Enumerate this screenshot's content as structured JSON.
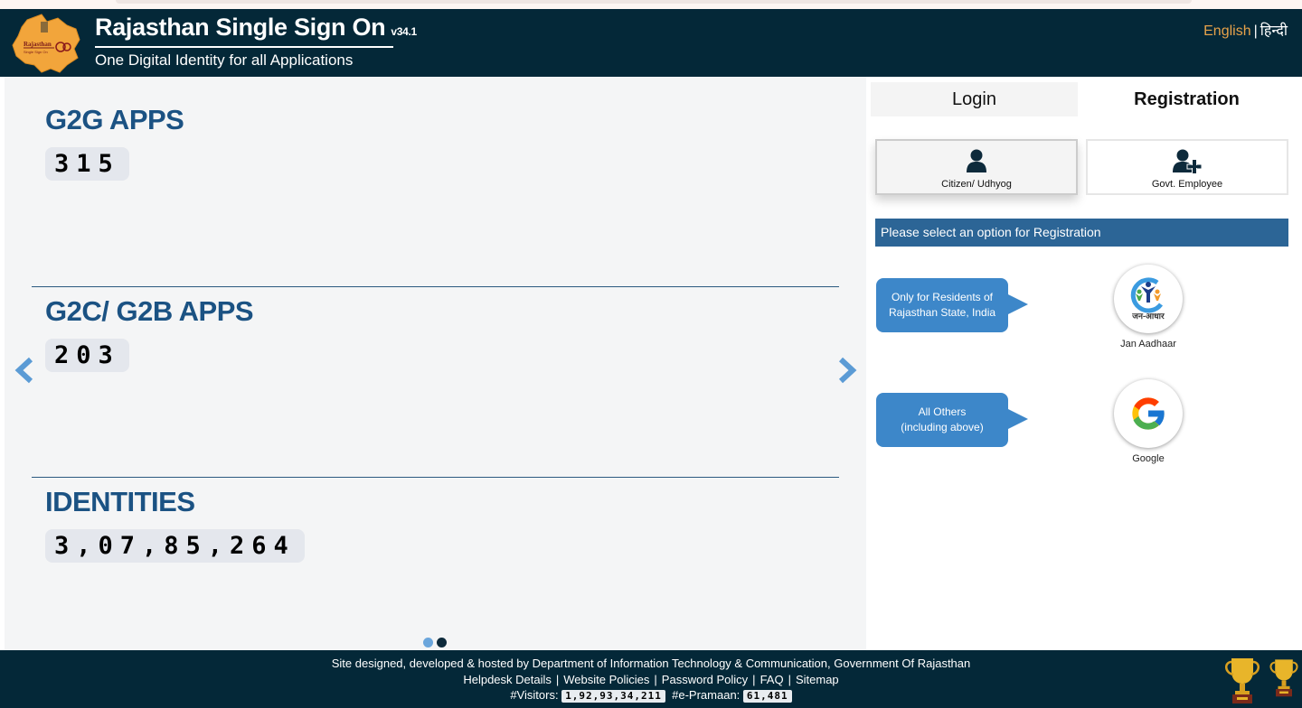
{
  "header": {
    "title": "Rajasthan Single Sign On",
    "version": "v34.1",
    "subtitle": "One Digital Identity for all Applications",
    "logo_alt": "Rajasthan Single Sign On logo",
    "language": {
      "english": "English",
      "separator": "|",
      "hindi": "हिन्दी"
    }
  },
  "stats": [
    {
      "label": "G2G APPS",
      "value": "315"
    },
    {
      "label": "G2C/ G2B APPS",
      "value": "203"
    },
    {
      "label": "IDENTITIES",
      "value": "3,07,85,264"
    }
  ],
  "carousel": {
    "prev_icon": "chevron-left-icon",
    "next_icon": "chevron-right-icon",
    "slides": 2,
    "active_slide": 2
  },
  "tabs": [
    {
      "label": "Login",
      "active": false
    },
    {
      "label": "Registration",
      "active": true
    }
  ],
  "registration": {
    "options": [
      {
        "label": "Citizen/ Udhyog",
        "icon": "user-icon",
        "selected": true
      },
      {
        "label": "Govt. Employee",
        "icon": "user-plus-icon",
        "selected": false
      }
    ],
    "notice": "Please select an option for Registration",
    "providers": [
      {
        "hint": "Only for Residents of Rajasthan State, India",
        "hint_line1": "Only for Residents of",
        "hint_line2": "Rajasthan State, India",
        "label": "Jan Aadhaar",
        "logo_text": "जन-आधार"
      },
      {
        "hint": "All Others (including above)",
        "hint_line1": "All Others",
        "hint_line2": "(including above)",
        "label": "Google"
      }
    ]
  },
  "footer": {
    "credit": "Site designed, developed & hosted by Department of Information Technology & Communication, Government Of Rajasthan",
    "links": [
      "Helpdesk Details",
      "Website Policies",
      "Password Policy",
      "FAQ",
      "Sitemap"
    ],
    "link_separator": "|",
    "visitors_label": "#Visitors:",
    "visitors_value": "1,92,93,34,211",
    "epramaan_label": "#e-Pramaan:",
    "epramaan_value": "61,481"
  },
  "colors": {
    "header_bg": "#042838",
    "heading_blue": "#1b5283",
    "notice_bg": "#2c6596",
    "bubble_bg": "#3d87c9",
    "lang_active": "#e6a24a",
    "arrow_blue": "#5b9bd5"
  }
}
